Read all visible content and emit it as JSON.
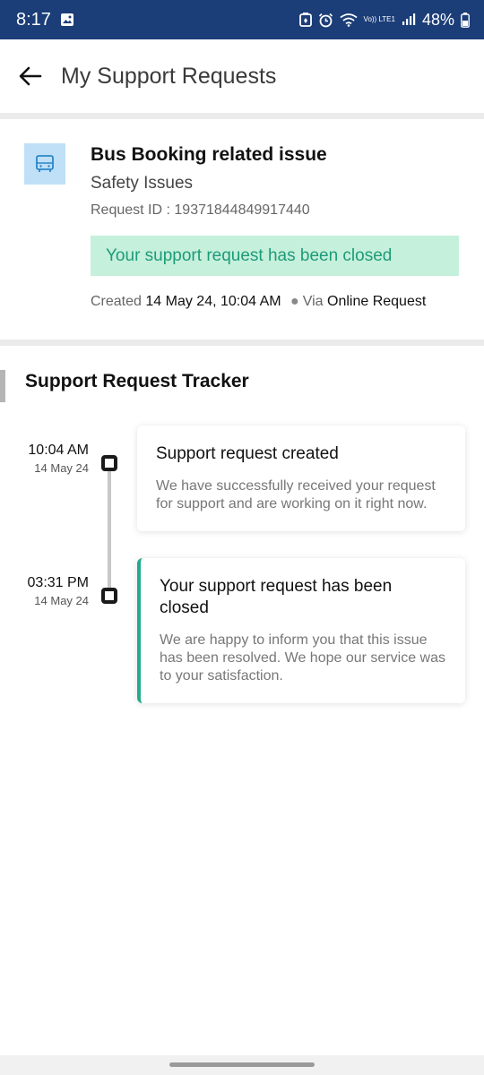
{
  "status_bar": {
    "time": "8:17",
    "battery": "48%",
    "network_label": "Vo)) LTE1",
    "icons": [
      "gallery-icon",
      "battery-saver-icon",
      "alarm-icon",
      "wifi-icon",
      "volte-icon",
      "signal-icon",
      "battery-icon"
    ]
  },
  "app_bar": {
    "title": "My Support Requests",
    "back_icon": "arrow-left-icon"
  },
  "request": {
    "icon": "bus-icon",
    "title": "Bus Booking related issue",
    "subcategory": "Safety Issues",
    "id_label": "Request ID :",
    "id_value": "19371844849917440",
    "status_text": "Your support request has been closed",
    "created_label": "Created",
    "created_value": "14 May 24, 10:04 AM",
    "via_label": "Via",
    "via_value": "Online Request"
  },
  "tracker": {
    "title": "Support Request Tracker",
    "events": [
      {
        "time": "10:04 AM",
        "date": "14 May 24",
        "title": "Support request created",
        "description": "We have successfully received your request for support and are working on it right now."
      },
      {
        "time": "03:31 PM",
        "date": "14 May 24",
        "title": "Your support request has been closed",
        "description": "We are happy to inform you that this issue has been resolved. We hope our service was to your satisfaction."
      }
    ]
  },
  "colors": {
    "status_bar": "#1b3d78",
    "banner_bg": "#c5f0dc",
    "banner_text": "#1e9b78",
    "accent": "#23ac8a",
    "icon_tile": "#bfe0f7"
  }
}
